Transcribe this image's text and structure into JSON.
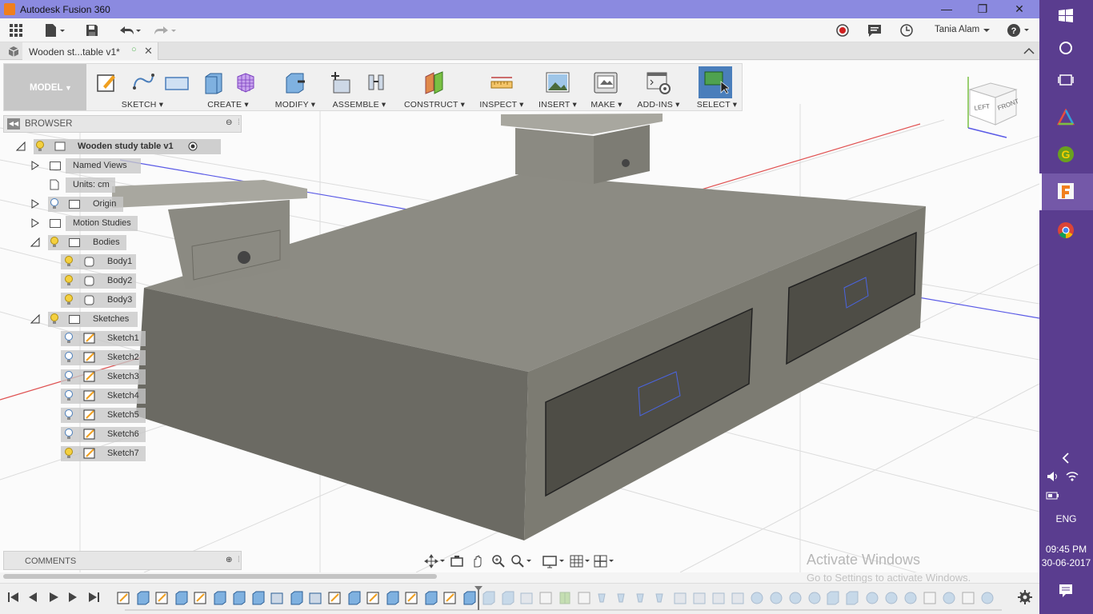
{
  "window": {
    "title": "Autodesk Fusion 360"
  },
  "qat": {
    "user": "Tania Alam"
  },
  "document_tab": {
    "title": "Wooden st...table v1*"
  },
  "toolbar": {
    "workspace": "MODEL",
    "groups": {
      "sketch": "SKETCH",
      "create": "CREATE",
      "modify": "MODIFY",
      "assemble": "ASSEMBLE",
      "construct": "CONSTRUCT",
      "inspect": "INSPECT",
      "insert": "INSERT",
      "make": "MAKE",
      "addins": "ADD-INS",
      "select": "SELECT"
    }
  },
  "browser": {
    "header": "BROWSER",
    "root": "Wooden study table v1",
    "named_views": "Named Views",
    "units": "Units: cm",
    "origin": "Origin",
    "motion_studies": "Motion Studies",
    "bodies": "Bodies",
    "body_items": [
      "Body1",
      "Body2",
      "Body3"
    ],
    "sketches": "Sketches",
    "sketch_items": [
      "Sketch1",
      "Sketch2",
      "Sketch3",
      "Sketch4",
      "Sketch5",
      "Sketch6",
      "Sketch7"
    ]
  },
  "viewcube": {
    "left": "LEFT",
    "front": "FRONT"
  },
  "comments": {
    "header": "COMMENTS"
  },
  "watermark": {
    "line1": "Activate Windows",
    "line2": "Go to Settings to activate Windows."
  },
  "taskbar": {
    "lang": "ENG",
    "time": "09:45 PM",
    "date": "30-06-2017"
  },
  "colors": {
    "titlebar": "#8b8ae0",
    "taskbar": "#5a3d8f",
    "accent": "#4a7ebb",
    "model": "#8b8a80"
  }
}
